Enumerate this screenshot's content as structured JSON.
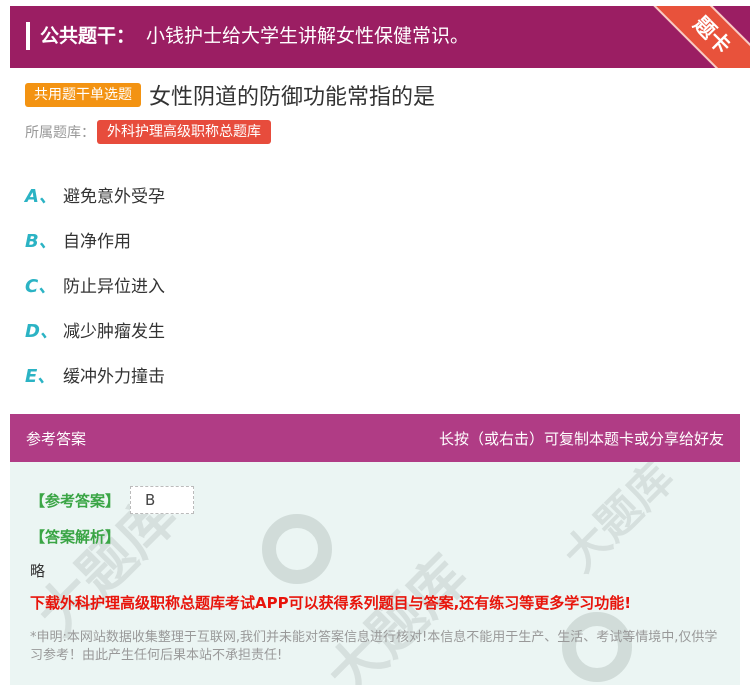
{
  "header": {
    "label": "公共题干：",
    "stem": "小钱护士给大学生讲解女性保健常识。",
    "corner_badge": "题卡"
  },
  "question": {
    "type_tag": "共用题干单选题",
    "title": "女性阴道的防御功能常指的是",
    "bank_label": "所属题库：",
    "bank_name": "外科护理高级职称总题库"
  },
  "options": [
    {
      "letter": "A、",
      "text": "避免意外受孕"
    },
    {
      "letter": "B、",
      "text": "自净作用"
    },
    {
      "letter": "C、",
      "text": "防止异位进入"
    },
    {
      "letter": "D、",
      "text": "减少肿瘤发生"
    },
    {
      "letter": "E、",
      "text": "缓冲外力撞击"
    }
  ],
  "answer_bar": {
    "left": "参考答案",
    "right": "长按（或右击）可复制本题卡或分享给好友"
  },
  "answer": {
    "answer_label": "【参考答案】",
    "answer_value": "B",
    "explanation_label": "【答案解析】",
    "explanation_text": "略",
    "promo": "下载外科护理高级职称总题库考试APP可以获得系列题目与答案,还有练习等更多学习功能!",
    "disclaimer": "*申明:本网站数据收集整理于互联网,我们并未能对答案信息进行核对!本信息不能用于生产、生活、考试等情境中,仅供学习参考！由此产生任何后果本站不承担责任!"
  },
  "colors": {
    "header_bg": "#9b1e63",
    "corner_bg": "#e8523b",
    "type_tag_bg": "#f39312",
    "bank_tag_bg": "#e74c3c",
    "option_letter": "#2bb3c4",
    "answer_bar_bg": "#b03c85",
    "answer_box_bg": "#ebf5f3",
    "green_label": "#3aa545",
    "promo_red": "#e8140b"
  }
}
